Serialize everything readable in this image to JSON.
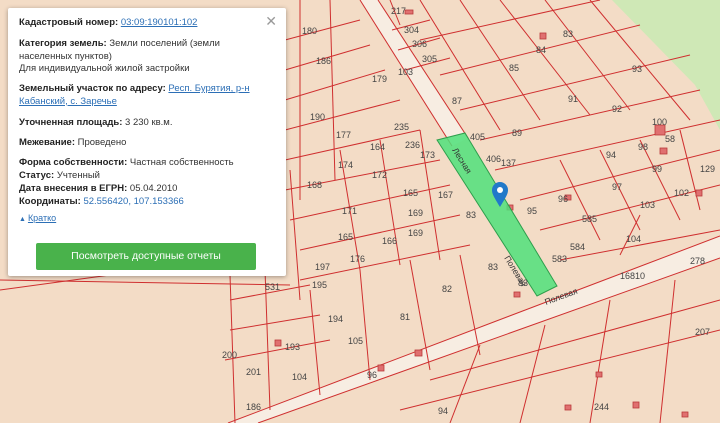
{
  "info_card": {
    "cadastral_label": "Кадастровый номер:",
    "cadastral_number": "03:09:190101:102",
    "category_label": "Категория земель:",
    "category_value": "Земли поселений (земли населенных пунктов)",
    "usage_value": "Для индивидуальной жилой застройки",
    "address_label": "Земельный участок по адресу:",
    "address_value": "Респ. Бурятия, р-н Кабанский, с. Заречье",
    "area_label": "Уточненная площадь:",
    "area_value": "3 230 кв.м.",
    "survey_label": "Межевание:",
    "survey_value": "Проведено",
    "ownership_label": "Форма собственности:",
    "ownership_value": "Частная собственность",
    "status_label": "Статус:",
    "status_value": "Учтенный",
    "egrn_label": "Дата внесения в ЕГРН:",
    "egrn_value": "05.04.2010",
    "coords_label": "Координаты:",
    "coords_value": "52.556420, 107.153366",
    "collapse_label": "Кратко",
    "reports_button": "Посмотреть доступные отчеты",
    "close_glyph": "✕"
  },
  "map": {
    "streets": [
      "Полевая",
      "Лесная",
      "Полевая"
    ],
    "plot_numbers": [
      "217",
      "304",
      "306",
      "305",
      "103",
      "84",
      "83",
      "85",
      "93",
      "180",
      "186",
      "179",
      "87",
      "405",
      "89",
      "91",
      "92",
      "190",
      "235",
      "236",
      "177",
      "164",
      "173",
      "406",
      "137",
      "94",
      "98",
      "99",
      "100",
      "58",
      "168",
      "174",
      "172",
      "165",
      "167",
      "83",
      "95",
      "96",
      "97",
      "129",
      "171",
      "169",
      "585",
      "103",
      "102",
      "165",
      "166",
      "169",
      "83",
      "584",
      "583",
      "104",
      "278",
      "176",
      "197",
      "198",
      "531",
      "82",
      "83",
      "195",
      "16810",
      "194",
      "81",
      "193",
      "105",
      "200",
      "201",
      "104",
      "96",
      "94",
      "244",
      "207",
      "186"
    ],
    "colors": {
      "background": "#f3dcc6",
      "parcel_border": "#cf2f2f",
      "selected_parcel": "#4fe07a",
      "forest": "#cfe8b6",
      "road": "#f7ede2",
      "marker": "#2179c9"
    },
    "icons": [
      "map-pin-icon",
      "close-icon",
      "triangle-up-icon"
    ]
  }
}
